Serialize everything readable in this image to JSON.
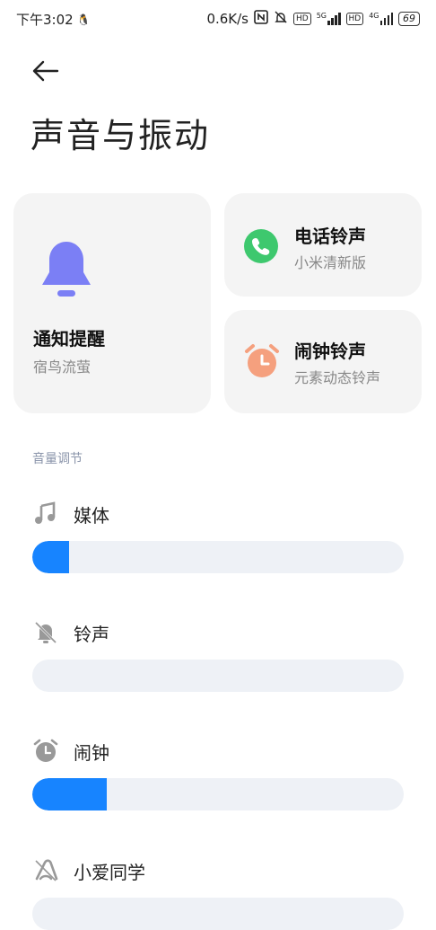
{
  "status_bar": {
    "time": "下午3:02",
    "net_speed": "0.6K/s",
    "hd1": "HD",
    "sig1_tag": "5G",
    "hd2": "HD",
    "sig2_tag": "4G",
    "battery": "69"
  },
  "header": {
    "title": "声音与振动"
  },
  "cards": {
    "notify": {
      "title": "通知提醒",
      "subtitle": "宿鸟流萤",
      "icon": "bell-icon",
      "color": "#7b7ff5"
    },
    "phone": {
      "title": "电话铃声",
      "subtitle": "小米清新版",
      "icon": "phone-icon",
      "color": "#3ec86e"
    },
    "alarm": {
      "title": "闹钟铃声",
      "subtitle": "元素动态铃声",
      "icon": "alarm-clock-icon",
      "color": "#f5a07e"
    }
  },
  "volume": {
    "section_label": "音量调节",
    "items": [
      {
        "label": "媒体",
        "icon": "music-note-icon",
        "level": 0.1
      },
      {
        "label": "铃声",
        "icon": "bell-muted-icon",
        "level": 0
      },
      {
        "label": "闹钟",
        "icon": "alarm-icon",
        "level": 0.2
      },
      {
        "label": "小爱同学",
        "icon": "xiaoai-icon",
        "level": 0
      }
    ]
  },
  "colors": {
    "accent": "#1784ff",
    "track": "#eef1f6"
  }
}
